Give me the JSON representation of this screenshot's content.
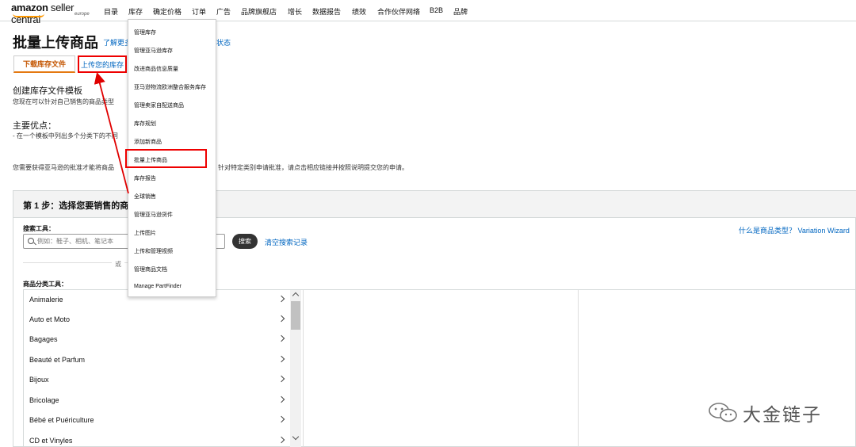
{
  "nav": {
    "logo_brand": "amazon",
    "logo_sc": "seller central",
    "logo_region": "europe",
    "items": [
      "目录",
      "库存",
      "确定价格",
      "订单",
      "广告",
      "品牌旗舰店",
      "增长",
      "数据报告",
      "绩效",
      "合作伙伴网络",
      "B2B",
      "品牌"
    ]
  },
  "header": {
    "title": "批量上传商品",
    "learn_more": "了解更多",
    "status_link": "状态"
  },
  "tabs": [
    "下载库存文件",
    "上传您的库存"
  ],
  "template_section": {
    "heading": "创建库存文件模板",
    "text": "您现在可以针对自己销售的商品类型"
  },
  "advantages": {
    "heading": "主要优点：",
    "text": "- 在一个模板中列出多个分类下的不同"
  },
  "approval_note": {
    "left": "您需要获得亚马逊的批准才能将商品",
    "right": "针对特定类别申请批准，请点击相应链接并按照说明提交您的申请。"
  },
  "step1": {
    "heading": "第 1 步：选择您要销售的商"
  },
  "search": {
    "label": "搜索工具：",
    "placeholder": "例如：鞋子、相机、笔记本",
    "button": "搜索",
    "clear_link": "清空搜索记录",
    "or_text": "或",
    "what_link": "什么是商品类型？ Variation Wizard"
  },
  "category_tool": {
    "label": "商品分类工具：",
    "items": [
      "Animalerie",
      "Auto et Moto",
      "Bagages",
      "Beauté et Parfum",
      "Bijoux",
      "Bricolage",
      "Bébé et Puériculture",
      "CD et Vinyles"
    ]
  },
  "dropdown": {
    "items": [
      "管理库存",
      "管理亚马逊库存",
      "改进商品信息质量",
      "亚马逊物流欧洲整合服务库存",
      "管理卖家自配送商品",
      "库存规划",
      "添加新商品",
      "批量上传商品",
      "库存报告",
      "全球销售",
      "管理亚马逊货件",
      "上传图片",
      "上传和管理视频",
      "管理商品文档",
      "Manage PartFinder"
    ],
    "highlighted_index": 7
  },
  "watermark": {
    "text": "大金链子"
  },
  "colors": {
    "link": "#0066c0",
    "highlight_red": "#e00000",
    "tab_orange": "#e47911"
  }
}
